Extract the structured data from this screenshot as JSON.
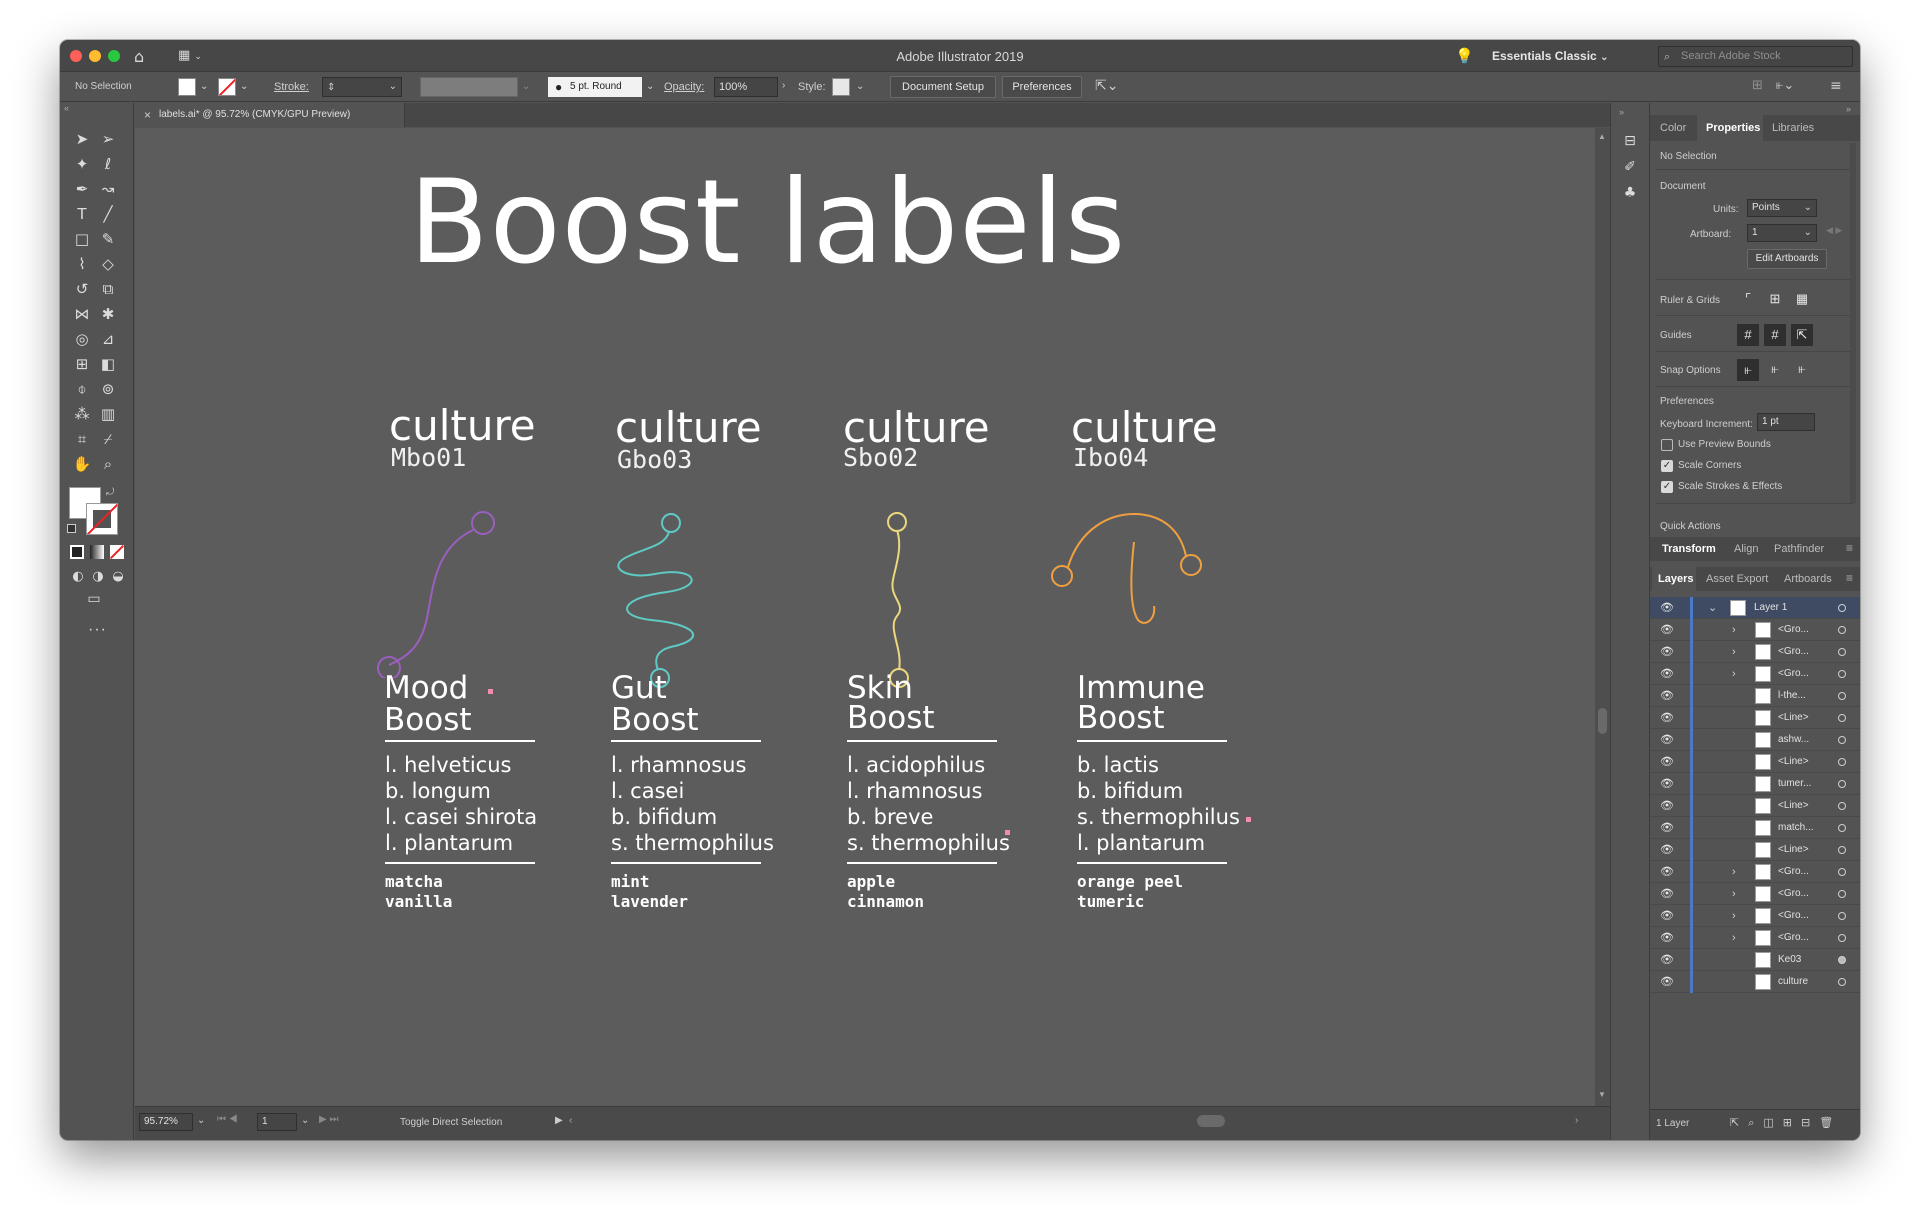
{
  "window": {
    "title": "Adobe Illustrator 2019",
    "workspace": "Essentials Classic",
    "search_placeholder": "Search Adobe Stock"
  },
  "controlbar": {
    "selection": "No Selection",
    "stroke_label": "Stroke:",
    "brush": "5 pt. Round",
    "opacity_label": "Opacity:",
    "opacity_value": "100%",
    "style_label": "Style:",
    "document_setup": "Document Setup",
    "preferences": "Preferences"
  },
  "doc_tab": {
    "title": "labels.ai* @ 95.72% (CMYK/GPU Preview)",
    "close": "×"
  },
  "artwork": {
    "heading": "Boost labels",
    "labels": [
      {
        "culture": "culture",
        "code": "Mbo01",
        "headline": [
          "Mood",
          "Boost"
        ],
        "strains": [
          "l. helveticus",
          "b. longum",
          "l. casei shirota",
          "l. plantarum"
        ],
        "flavors": [
          "matcha",
          "vanilla"
        ],
        "color": "#9b5fbf"
      },
      {
        "culture": "culture",
        "code": "Gbo03",
        "headline": [
          "Gut",
          "Boost"
        ],
        "strains": [
          "l. rhamnosus",
          "l. casei",
          "b. bifidum",
          "s. thermophilus"
        ],
        "flavors": [
          "mint",
          "lavender"
        ],
        "color": "#5fc9c4"
      },
      {
        "culture": "culture",
        "code": "Sbo02",
        "headline": [
          "Skin",
          "Boost"
        ],
        "strains": [
          "l. acidophilus",
          "l. rhamnosus",
          "b. breve",
          "s. thermophilus"
        ],
        "flavors": [
          "apple",
          "cinnamon"
        ],
        "color": "#ecd77d"
      },
      {
        "culture": "culture",
        "code": "Ibo04",
        "headline": [
          "Immune",
          "Boost"
        ],
        "strains": [
          "b. lactis",
          "b. bifidum",
          "s. thermophilus",
          "l. plantarum"
        ],
        "flavors": [
          "orange peel",
          "tumeric"
        ],
        "color": "#f0a040"
      }
    ]
  },
  "status": {
    "zoom": "95.72%",
    "artboard": "1",
    "tool": "Toggle Direct Selection"
  },
  "panel": {
    "tabs": [
      "Color",
      "Properties",
      "Libraries"
    ],
    "active_tab": "Properties",
    "selection": "No Selection",
    "document": {
      "title": "Document",
      "units_label": "Units:",
      "units": "Points",
      "artboard_label": "Artboard:",
      "artboard": "1",
      "edit_artboards": "Edit Artboards"
    },
    "ruler_grids": "Ruler & Grids",
    "guides": "Guides",
    "snap_options": "Snap Options",
    "preferences": {
      "title": "Preferences",
      "keyboard_increment_label": "Keyboard Increment:",
      "keyboard_increment": "1 pt",
      "use_preview_bounds": "Use Preview Bounds",
      "scale_corners": "Scale Corners",
      "scale_strokes": "Scale Strokes & Effects",
      "checked": [
        false,
        true,
        true
      ]
    },
    "quick_actions": "Quick Actions",
    "tabs2": [
      "Transform",
      "Align",
      "Pathfinder"
    ],
    "tabs3": [
      "Layers",
      "Asset Export",
      "Artboards"
    ],
    "layer_top": "Layer 1",
    "layers": [
      "<Gro...",
      "<Gro...",
      "<Gro...",
      "l-the...",
      "<Line>",
      "ashw...",
      "<Line>",
      "tumer...",
      "<Line>",
      "match...",
      "<Line>",
      "<Gro...",
      "<Gro...",
      "<Gro...",
      "<Gro...",
      "Ke03",
      "culture"
    ],
    "layer_count": "1 Layer"
  }
}
